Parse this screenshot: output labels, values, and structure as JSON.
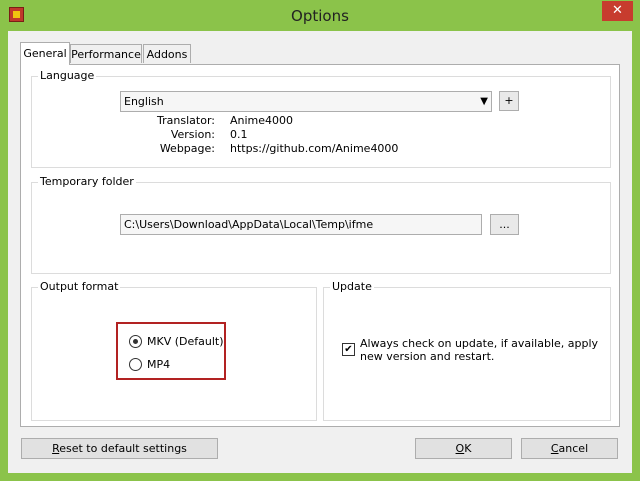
{
  "window": {
    "title": "Options",
    "close_glyph": "✕"
  },
  "tabs": [
    {
      "label": "General",
      "active": true
    },
    {
      "label": "Performance",
      "active": false
    },
    {
      "label": "Addons",
      "active": false
    }
  ],
  "language": {
    "group_title": "Language",
    "selected": "English",
    "add_label": "+",
    "translator_label": "Translator:",
    "translator_value": "Anime4000",
    "version_label": "Version:",
    "version_value": "0.1",
    "webpage_label": "Webpage:",
    "webpage_value": "https://github.com/Anime4000"
  },
  "temp_folder": {
    "group_title": "Temporary folder",
    "path": "C:\\Users\\Download\\AppData\\Local\\Temp\\ifme",
    "browse_label": "..."
  },
  "output_format": {
    "group_title": "Output format",
    "options": [
      {
        "label": "MKV (Default)",
        "checked": true
      },
      {
        "label": "MP4",
        "checked": false
      }
    ]
  },
  "update": {
    "group_title": "Update",
    "checkbox_line1": "Always check on update, if available, apply",
    "checkbox_line2": "new version and restart.",
    "checked": true
  },
  "footer": {
    "reset_pre": "",
    "reset_u": "R",
    "reset_post": "eset to default settings",
    "ok_u": "O",
    "ok_post": "K",
    "cancel_u": "C",
    "cancel_post": "ancel"
  },
  "colors": {
    "frame": "#8bc34a",
    "close": "#c73c2e",
    "highlight": "#b22222"
  }
}
